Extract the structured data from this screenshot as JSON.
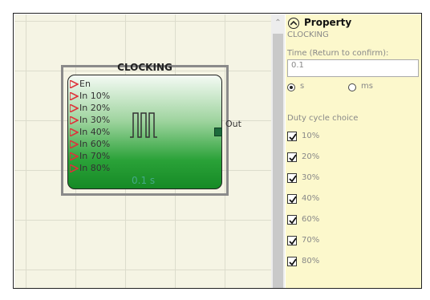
{
  "block": {
    "title": "CLOCKING",
    "inputs": [
      "En",
      "In 10%",
      "In 20%",
      "In 30%",
      "In 40%",
      "In 60%",
      "In 70%",
      "In 80%"
    ],
    "output_label": "Out",
    "frequency": "0.1 s",
    "pin_color": "#e0303a"
  },
  "property": {
    "header": "Property",
    "subtitle": "CLOCKING",
    "time_label": "Time (Return to confirm):",
    "time_value": "0.1",
    "unit_s": "s",
    "unit_ms": "ms",
    "selected_unit": "s",
    "duty_label": "Duty cycle choice",
    "duty": [
      {
        "label": "10%",
        "checked": true
      },
      {
        "label": "20%",
        "checked": true
      },
      {
        "label": "30%",
        "checked": true
      },
      {
        "label": "40%",
        "checked": true
      },
      {
        "label": "60%",
        "checked": true
      },
      {
        "label": "70%",
        "checked": true
      },
      {
        "label": "80%",
        "checked": true
      }
    ]
  },
  "icons": {
    "collapse": "chevron-up-icon",
    "scroll_up": "scroll-up-arrow-icon",
    "check": "check-icon"
  }
}
